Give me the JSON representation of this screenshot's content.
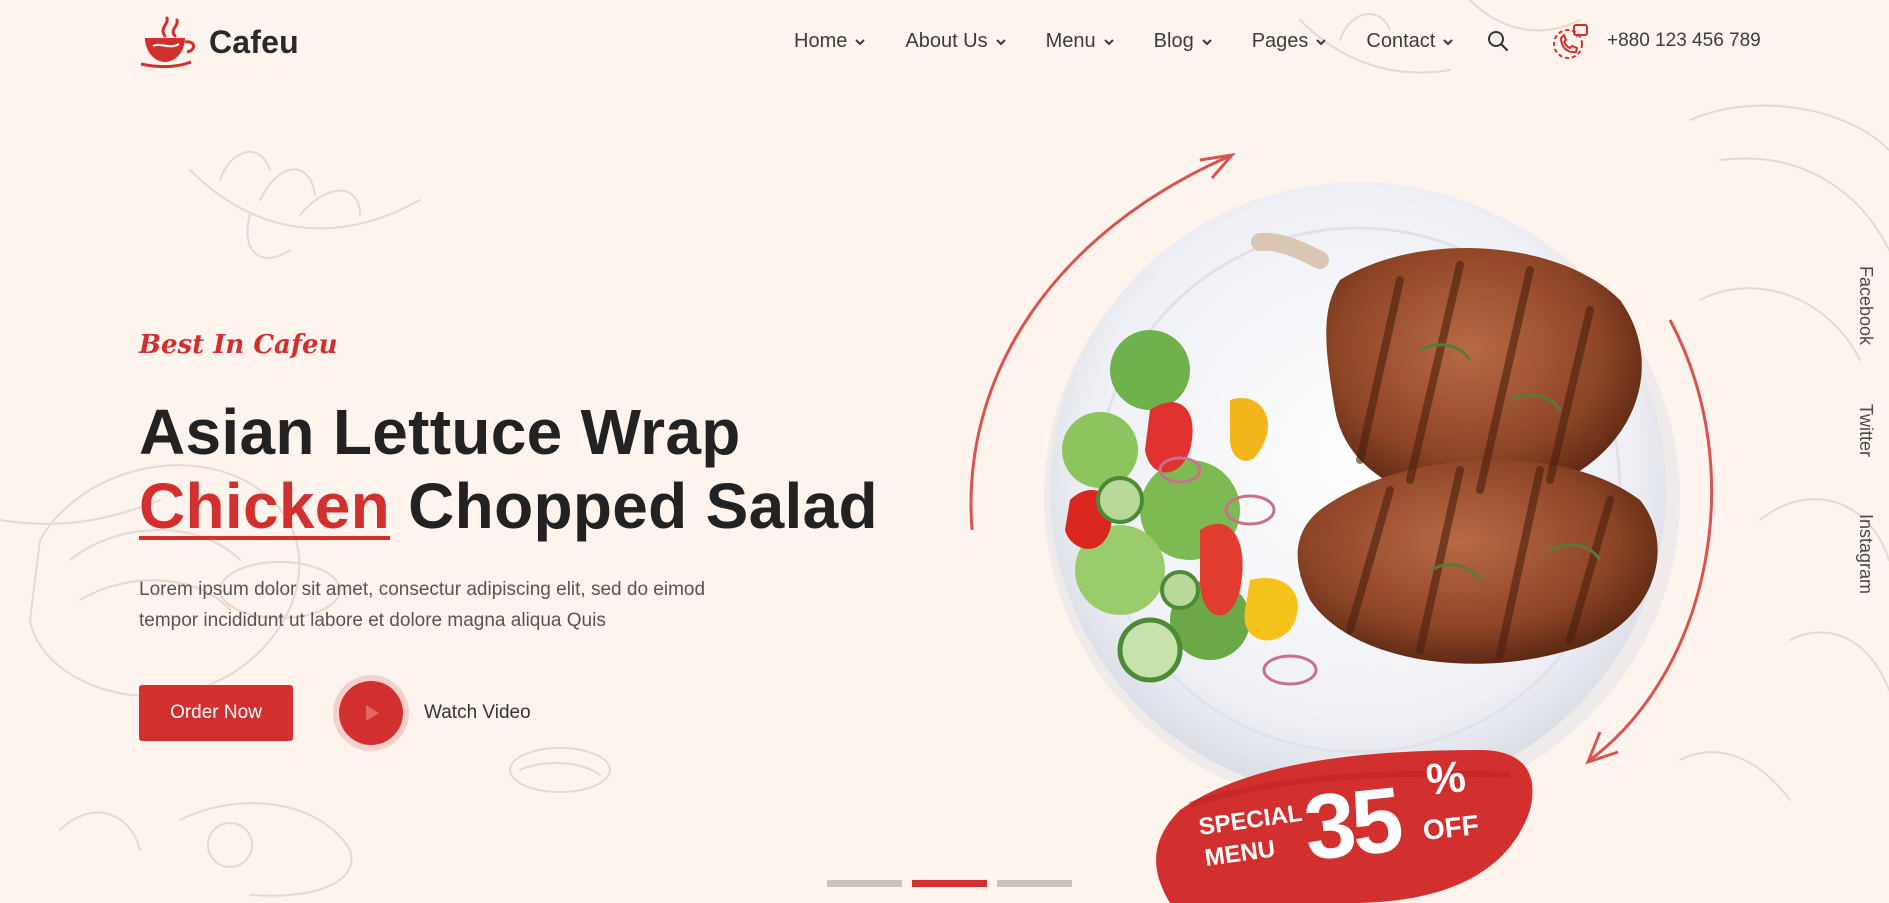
{
  "brand": {
    "name": "Cafeu",
    "accent": "#d2302f"
  },
  "nav": {
    "items": [
      {
        "label": "Home"
      },
      {
        "label": "About Us"
      },
      {
        "label": "Menu"
      },
      {
        "label": "Blog"
      },
      {
        "label": "Pages"
      },
      {
        "label": "Contact"
      }
    ],
    "phone": "+880 123 456 789"
  },
  "social": [
    "Facebook",
    "Twitter",
    "Instagram"
  ],
  "hero": {
    "tagline": "Best In Cafeu",
    "headline_line1": "Asian Lettuce Wrap",
    "headline_accent": "Chicken",
    "headline_rest": " Chopped Salad",
    "description_line1": "Lorem ipsum dolor sit amet, consectur adipiscing elit, sed do eimod",
    "description_line2": "tempor incididunt ut labore et dolore magna aliqua Quis",
    "order_button": "Order Now",
    "watch_label": "Watch Video"
  },
  "promo": {
    "special": "SPECIAL",
    "menu": "MENU",
    "percent": "35",
    "percent_sign": "%",
    "off": "OFF"
  },
  "slider": {
    "count": 3,
    "active_index": 1
  },
  "icons": [
    "logo-cup-icon",
    "chevron-down-icon",
    "search-icon",
    "phone-icon",
    "play-icon"
  ]
}
